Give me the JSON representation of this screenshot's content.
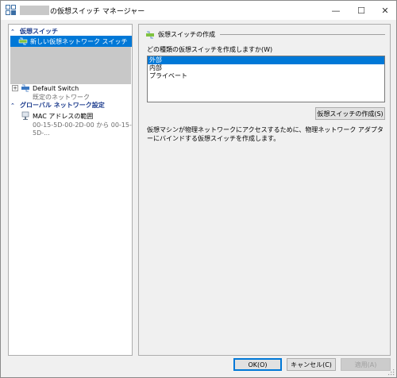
{
  "window": {
    "title": "の仮想スイッチ マネージャー",
    "controls": {
      "minimize": "—",
      "maximize": "☐",
      "close": "✕"
    }
  },
  "left_pane": {
    "groups": [
      {
        "label": "仮想スイッチ"
      },
      {
        "label": "グローバル ネットワーク設定"
      }
    ],
    "new_switch_item": "新しい仮想ネットワーク スイッチ",
    "default_switch": {
      "label": "Default Switch",
      "sub": "既定のネットワーク"
    },
    "mac_range": {
      "label": "MAC アドレスの範囲",
      "sub": "00-15-5D-00-2D-00 から 00-15-5D-..."
    }
  },
  "right_pane": {
    "section_title": "仮想スイッチの作成",
    "question": "どの種類の仮想スイッチを作成しますか(W)",
    "options": [
      "外部",
      "内部",
      "プライベート"
    ],
    "selected_option": "外部",
    "create_button": "仮想スイッチの作成(S)",
    "description": "仮想マシンが物理ネットワークにアクセスするために、物理ネットワーク アダプターにバインドする仮想スイッチを作成します。"
  },
  "buttons": {
    "ok": "OK(O)",
    "cancel": "キャンセル(C)",
    "apply": "適用(A)"
  },
  "colors": {
    "selection": "#0078d7",
    "group_header": "#1a3a8c"
  }
}
